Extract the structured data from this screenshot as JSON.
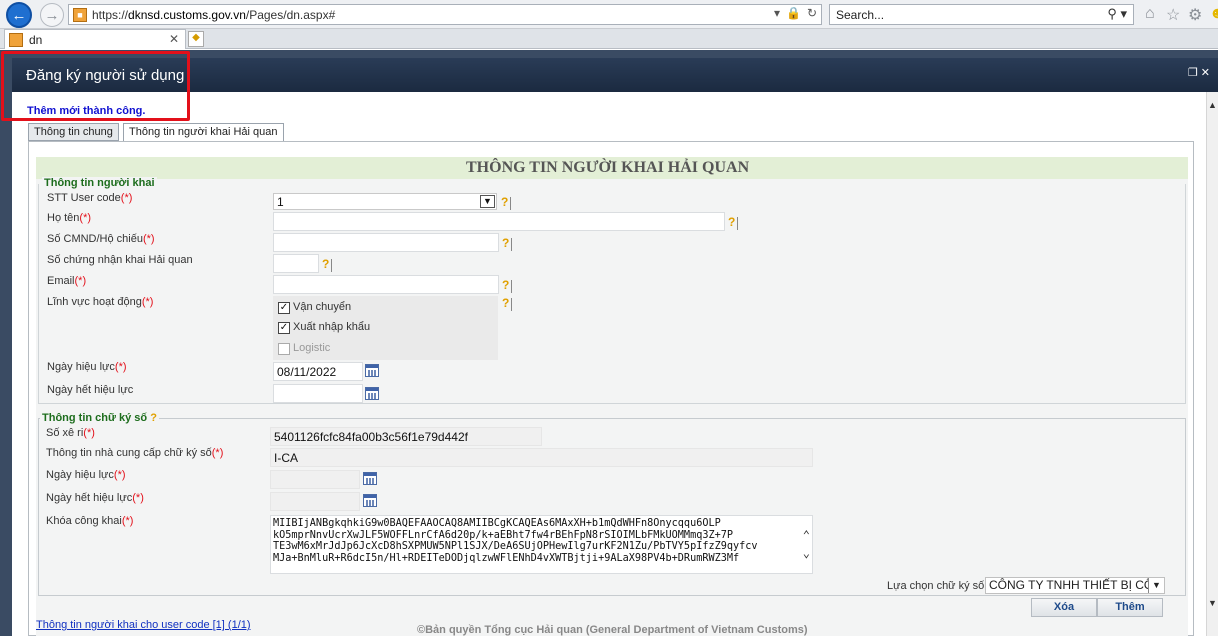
{
  "browser": {
    "url_prefix": "https://",
    "url_domain": "dknsd.customs.gov.vn",
    "url_path": "/Pages/dn.aspx#",
    "search_placeholder": "Search...",
    "tab_title": "dn"
  },
  "dialog": {
    "title": "Đăng ký người sử dụng",
    "success_message": "Thêm mới thành công.",
    "tabs": [
      {
        "label": "Thông tin chung"
      },
      {
        "label": "Thông tin người khai Hải quan"
      }
    ],
    "heading": "THÔNG TIN NGƯỜI KHAI HẢI QUAN"
  },
  "declarant": {
    "legend": "Thông tin người khai",
    "stt_label": "STT User code",
    "stt_value": "1",
    "name_label": "Họ tên",
    "name_value": "",
    "id_label": "Số CMND/Hộ chiếu",
    "id_value": "",
    "cert_label": "Số chứng nhận khai Hải quan",
    "cert_value": "",
    "email_label": "Email",
    "email_value": "",
    "field_label": "Lĩnh vực hoạt động",
    "fields": [
      {
        "label": "Vận chuyển",
        "checked": true,
        "disabled": false
      },
      {
        "label": "Xuất nhập khẩu",
        "checked": true,
        "disabled": false
      },
      {
        "label": "Logistic",
        "checked": false,
        "disabled": true
      }
    ],
    "effective_label": "Ngày hiệu lực",
    "effective_value": "08/11/2022",
    "expiry_label": "Ngày hết hiệu lực",
    "expiry_value": ""
  },
  "signature": {
    "legend": "Thông tin chữ ký số",
    "serial_label": "Số xê ri",
    "serial_value": "5401126fcfc84fa00b3c56f1e79d442f",
    "provider_label": "Thông tin nhà cung cấp chữ ký số",
    "provider_value": "I-CA",
    "effective_label": "Ngày hiệu lực",
    "expiry_label": "Ngày hết hiệu lực",
    "pubkey_label": "Khóa công khai",
    "pubkey_lines": [
      "MIIBIjANBgkqhkiG9w0BAQEFAAOCAQ8AMIIBCgKCAQEAs6MAxXH+b1mQdWHFn8Onycqqu6OLP",
      "kO5mprNnvUcrXwJLF5WOFFLnrCfA6d20p/k+aEBht7fw4rBEhFpN8rSIOIMLbFMkUOMMmq3Z+7P",
      "TE3wM6xMrJdJp6JcXcD8hSXPMUW5NPl1SJX/DeA6SUjOPHewIlg7urKF2N1Zu/PbTVY5pIfzZ9qyfcv",
      "MJa+BnMluR+R6dcI5n/Hl+RDEITeDODjqlzwWFlENhD4vXWTBjtji+9ALaX98PV4b+DRumRWZ3Mf"
    ],
    "select_label": "Lựa chọn chữ ký số",
    "select_value": "CÔNG TY TNHH THIẾT BỊ CÔNG"
  },
  "actions": {
    "delete_label": "Xóa",
    "add_label": "Thêm"
  },
  "pagination_note": "Thông tin người khai cho user code [1] (1/1)",
  "footer": "©Bản quyền Tổng cục Hải quan (General Department of Vietnam Customs)",
  "required_mark": "(*)",
  "help_mark": "?"
}
